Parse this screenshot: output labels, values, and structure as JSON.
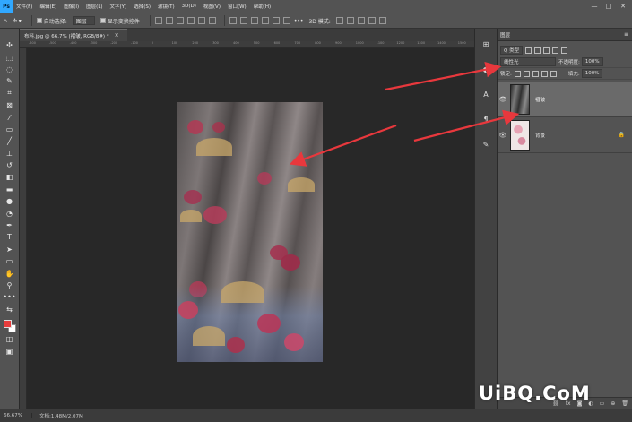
{
  "menubar": {
    "logo": "Ps",
    "items": [
      "文件(F)",
      "编辑(E)",
      "图像(I)",
      "图层(L)",
      "文字(Y)",
      "选择(S)",
      "滤镜(T)",
      "3D(D)",
      "视图(V)",
      "窗口(W)",
      "帮助(H)"
    ],
    "minimize": "—",
    "maximize": "□",
    "close": "✕"
  },
  "options": {
    "auto_select_label": "自动选择:",
    "auto_select_value": "图层",
    "show_transform_label": "显示变换控件",
    "mode_3d_label": "3D 模式:",
    "more": "•••"
  },
  "document_tab": {
    "title": "布料.jpg @ 66.7% (褶皱, RGB/8#) *",
    "close": "×"
  },
  "ruler": {
    "marks": [
      "-600",
      "-500",
      "-400",
      "-300",
      "-200",
      "-100",
      "0",
      "100",
      "200",
      "300",
      "400",
      "500",
      "600",
      "700",
      "800",
      "900",
      "1000",
      "1100",
      "1200",
      "1300",
      "1400",
      "1500"
    ]
  },
  "status": {
    "zoom": "66.67%",
    "doc_size": "文档:1.48M/2.07M"
  },
  "layers_panel": {
    "title": "图层",
    "menu": "≡",
    "filter_kind": "Q 类型",
    "blend_mode": "线性光",
    "opacity_label": "不透明度:",
    "opacity_value": "100%",
    "lock_label": "锁定:",
    "fill_label": "填充:",
    "fill_value": "100%",
    "layers": [
      {
        "name": "褶皱",
        "visible": true,
        "selected": true
      },
      {
        "name": "背景",
        "visible": true,
        "selected": false,
        "locked": true
      }
    ]
  },
  "watermark": "UiBQ.CoM",
  "colors": {
    "arrow": "#e8383d",
    "foreground": "#e63b3b",
    "background": "#ffffff",
    "accent": "#31a8ff"
  }
}
